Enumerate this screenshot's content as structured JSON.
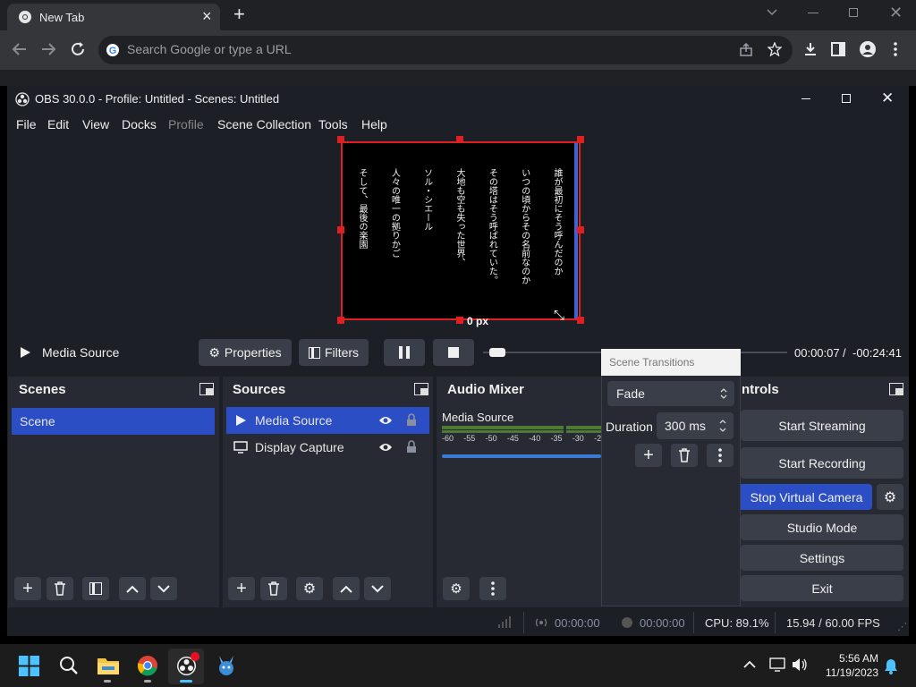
{
  "browser": {
    "tab_title": "New Tab",
    "omnibox_placeholder": "Search Google or type a URL"
  },
  "obs": {
    "window_title": "OBS 30.0.0 - Profile: Untitled - Scenes: Untitled",
    "menu": [
      "File",
      "Edit",
      "View",
      "Docks",
      "Profile",
      "Scene Collection",
      "Tools",
      "Help"
    ],
    "preview": {
      "dimension_label": "0 px",
      "text_columns": [
        "誰が最初にそう呼んだのか",
        "いつの頃からその名前なのか",
        "その塔はそう呼ばれていた。",
        "大地も空も失った世界、",
        "ソル・シエール",
        "人々の唯一の拠りかご",
        "そして、最後の楽園"
      ]
    },
    "media_controls": {
      "source_name": "Media Source",
      "properties_label": "Properties",
      "filters_label": "Filters",
      "elapsed": "00:00:07",
      "separator": "/",
      "remaining": "-00:24:41",
      "progress_fraction": 0.02
    },
    "scenes": {
      "title": "Scenes",
      "items": [
        "Scene"
      ]
    },
    "sources": {
      "title": "Sources",
      "items": [
        {
          "name": "Media Source"
        },
        {
          "name": "Display Capture"
        }
      ]
    },
    "audio_mixer": {
      "title": "Audio Mixer",
      "channel": "Media Source",
      "scale": [
        "-60",
        "-55",
        "-50",
        "-45",
        "-40",
        "-35",
        "-30",
        "-25"
      ]
    },
    "controls": {
      "title": "Controls",
      "title_visible": "ntrols",
      "start_streaming": "Start Streaming",
      "start_recording": "Start Recording",
      "stop_virtual_camera": "Stop Virtual Camera",
      "studio_mode": "Studio Mode",
      "settings": "Settings",
      "exit": "Exit"
    },
    "scene_transitions": {
      "title": "Scene Transitions",
      "selected": "Fade",
      "duration_label": "Duration",
      "duration_value": "300 ms"
    },
    "status": {
      "stream_time": "00:00:00",
      "record_time": "00:00:00",
      "cpu": "CPU: 89.1%",
      "fps": "15.94 / 60.00 FPS"
    }
  },
  "taskbar": {
    "time": "5:56 AM",
    "date": "11/19/2023"
  },
  "colors": {
    "accent": "#2c4ec4",
    "selection_red": "#e02020",
    "panel": "#272a33",
    "window": "#1d1f26"
  }
}
